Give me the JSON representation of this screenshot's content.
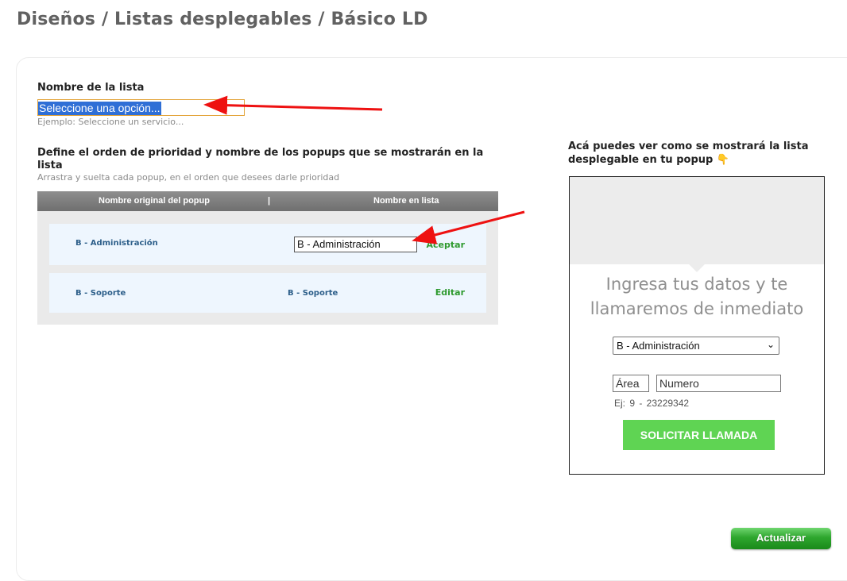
{
  "page": {
    "title": "Diseños / Listas desplegables / Básico LD"
  },
  "list_name": {
    "label": "Nombre de la lista",
    "value": "Seleccione una opción...",
    "hint": "Ejemplo: Seleccione un servicio..."
  },
  "priority": {
    "title": "Define el orden de prioridad y nombre de los popups que se mostrarán en la lista",
    "subtitle": "Arrastra y suelta cada popup, en el orden que desees darle prioridad",
    "headers": {
      "original": "Nombre original del popup",
      "separator": "|",
      "list_name": "Nombre en lista"
    },
    "rows": [
      {
        "original": "B - Administración",
        "list_value": "B - Administración",
        "action": "Aceptar"
      },
      {
        "original": "B - Soporte",
        "list_value": "B - Soporte",
        "action": "Editar"
      }
    ]
  },
  "preview": {
    "title": "Acá puedes ver como se mostrará la lista desplegable en tu popup 👇",
    "heading": "Ingresa tus datos y te llamaremos de inmediato",
    "select_value": "B - Administración",
    "area_value": "Área",
    "number_value": "Numero",
    "example": "Ej: 9  -  23229342",
    "button": "SOLICITAR LLAMADA"
  },
  "actions": {
    "update": "Actualizar"
  },
  "colors": {
    "accent_green": "#5fd453",
    "action_green": "#2f9a2f",
    "selection_blue": "#2f6fd6",
    "annotation_red": "#ee1111"
  },
  "icons": {
    "dropdown": "chevron-down-icon",
    "annotation": "red-arrow-annotation"
  }
}
